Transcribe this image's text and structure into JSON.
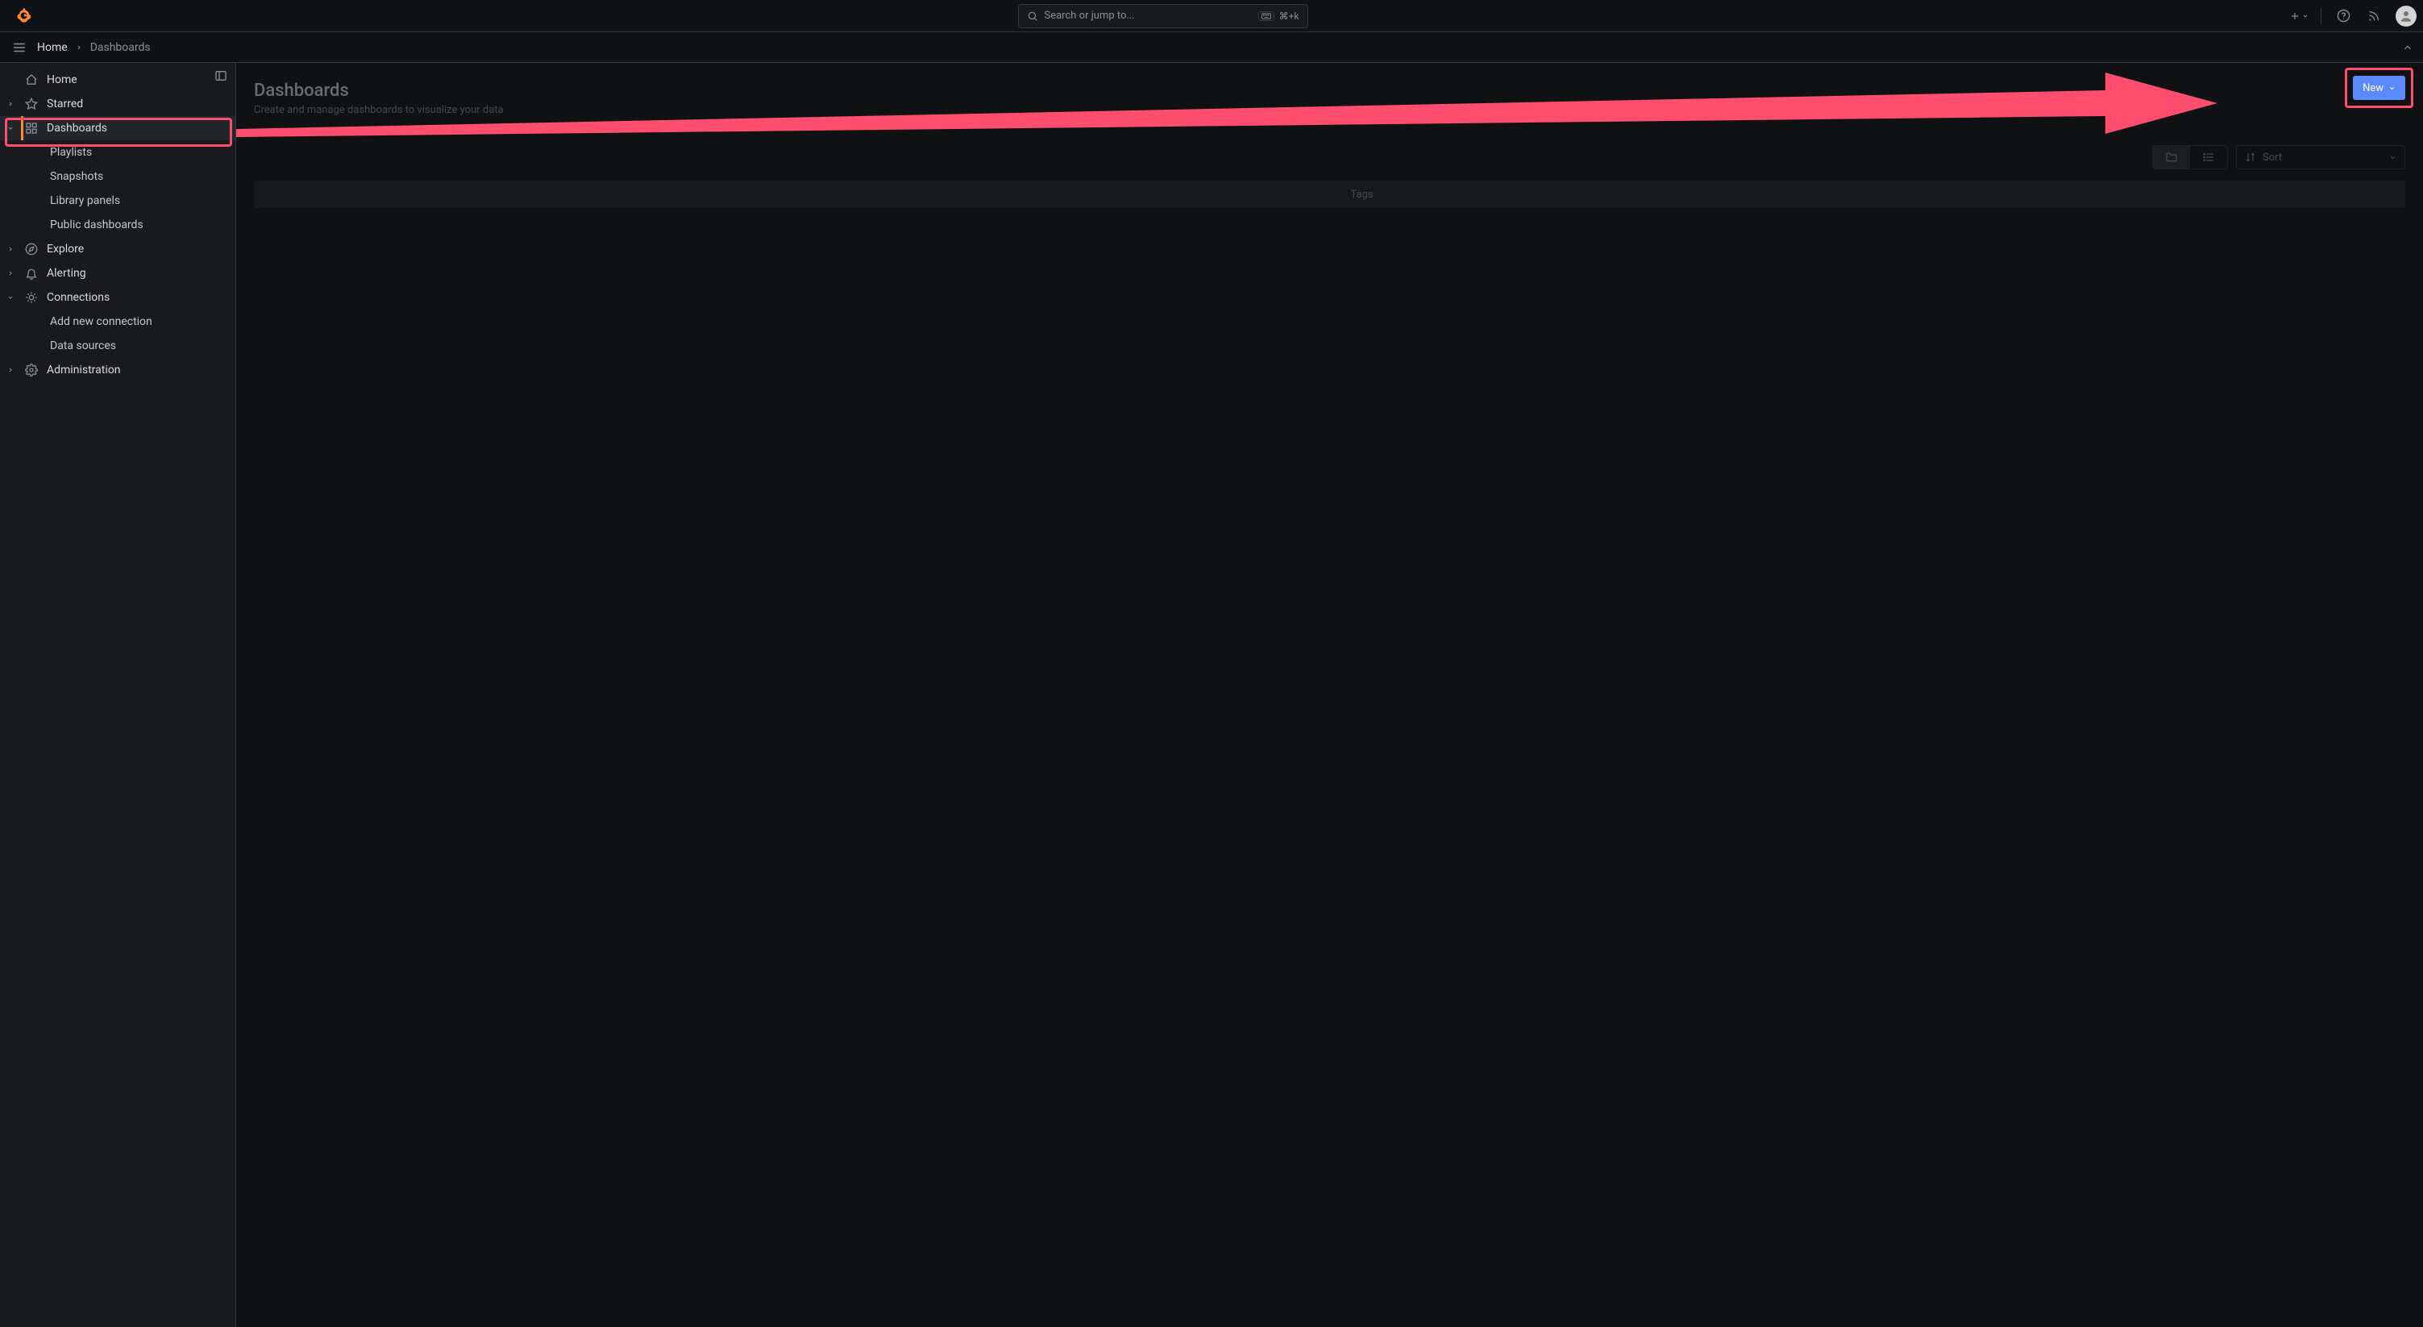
{
  "topbar": {
    "search_placeholder": "Search or jump to...",
    "kbd_hint": "⌘+k"
  },
  "breadcrumbs": {
    "home": "Home",
    "current": "Dashboards"
  },
  "sidebar": {
    "home": "Home",
    "starred": "Starred",
    "dashboards": "Dashboards",
    "playlists": "Playlists",
    "snapshots": "Snapshots",
    "library_panels": "Library panels",
    "public_dashboards": "Public dashboards",
    "explore": "Explore",
    "alerting": "Alerting",
    "connections": "Connections",
    "add_connection": "Add new connection",
    "data_sources": "Data sources",
    "administration": "Administration"
  },
  "page": {
    "title": "Dashboards",
    "subtitle": "Create and manage dashboards to visualize your data",
    "new_button": "New",
    "sort_label": "Sort",
    "column_tags": "Tags"
  },
  "annotation": {
    "highlight_color": "#ff4d6d"
  }
}
